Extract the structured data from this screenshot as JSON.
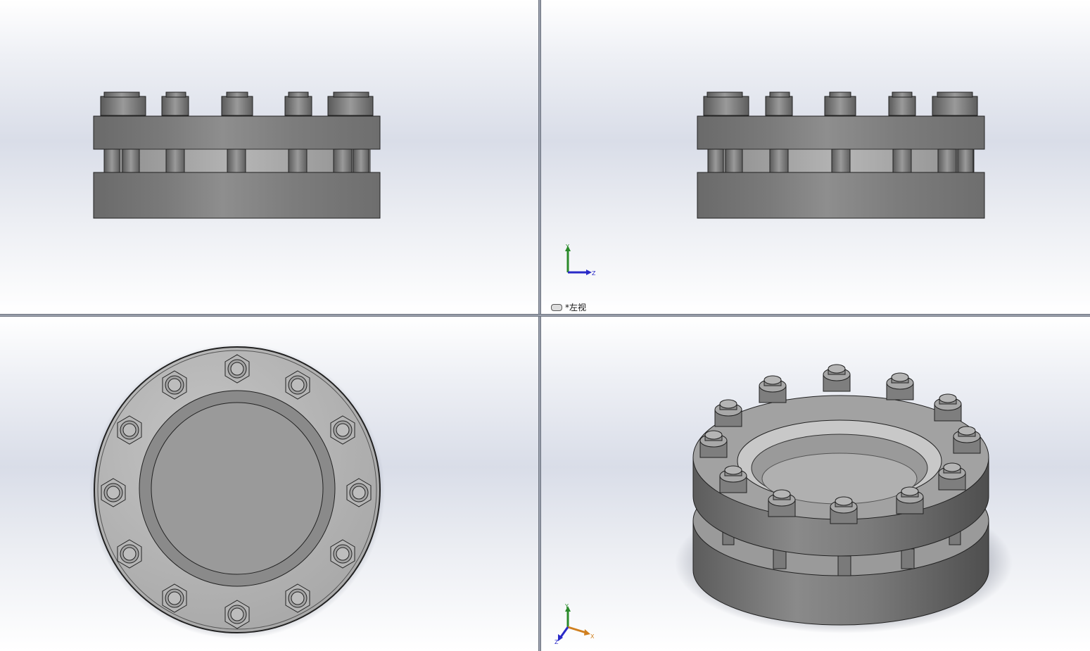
{
  "viewports": {
    "front": {
      "name": "front-view"
    },
    "left": {
      "name": "left-view",
      "label": "*左视",
      "label_active": true
    },
    "top": {
      "name": "top-view"
    },
    "iso": {
      "name": "isometric-view"
    }
  },
  "triad": {
    "left_view": {
      "axis1": "Y",
      "axis2": "Z"
    },
    "iso_view": {
      "axis1": "Y",
      "axis2": "X",
      "axis3": "Z"
    }
  },
  "colors": {
    "steel_dark": "#6b6b6b",
    "steel_mid": "#8a8a8a",
    "steel_light": "#b8b8b8",
    "axis_y": "#2a8a2a",
    "axis_z": "#2a2ac8",
    "axis_x": "#d08020"
  }
}
